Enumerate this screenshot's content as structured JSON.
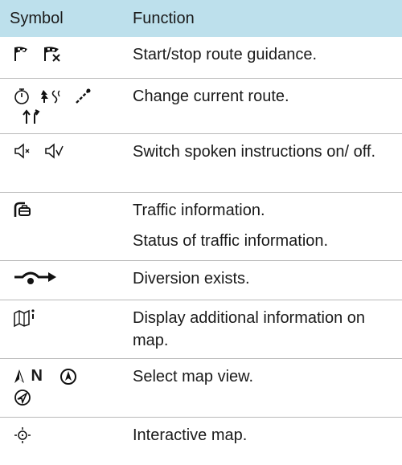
{
  "header": {
    "symbol": "Symbol",
    "function": "Function"
  },
  "rows": [
    {
      "icons": [
        "flag-start-icon",
        "flag-stop-icon"
      ],
      "text": "Start/stop route guidance."
    },
    {
      "icons": [
        "stopwatch-icon",
        "scenic-route-icon",
        "route-sign-icon",
        "lanes-icon"
      ],
      "text": "Change current route."
    },
    {
      "icons": [
        "speaker-off-icon",
        "speaker-on-icon"
      ],
      "text": "Switch spoken instructions on/ off."
    },
    {
      "icons": [
        "traffic-info-icon"
      ],
      "text": "Traffic information.",
      "text2": "Status of traffic information."
    },
    {
      "icons": [
        "diversion-icon"
      ],
      "text": "Diversion exists."
    },
    {
      "icons": [
        "map-info-icon"
      ],
      "text": "Display additional information on map."
    },
    {
      "icons": [
        "north-up-icon",
        "compass-icon",
        "heading-icon"
      ],
      "text": "Select map view.",
      "north_label": "N"
    },
    {
      "icons": [
        "interactive-map-icon"
      ],
      "text": "Interactive map."
    }
  ]
}
